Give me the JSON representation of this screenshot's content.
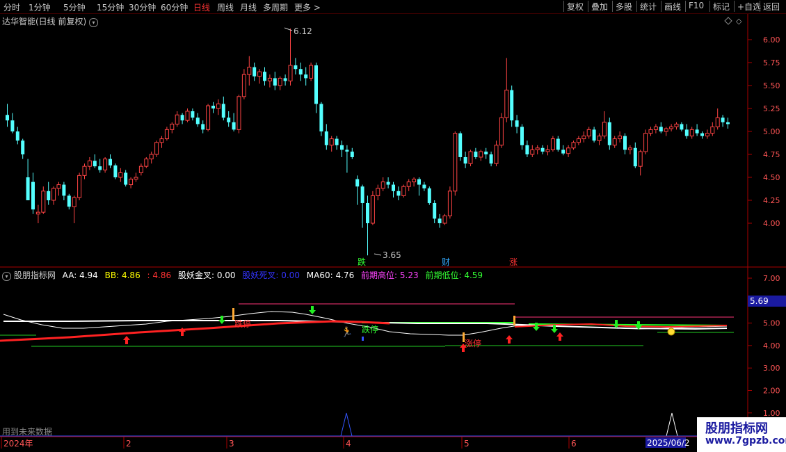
{
  "toolbar": {
    "periods": [
      "分时",
      "1分钟",
      "5分钟",
      "15分钟",
      "30分钟",
      "60分钟",
      "日线",
      "周线",
      "月线",
      "多周期",
      "更多 >"
    ],
    "active_period": "日线",
    "right_buttons": [
      "复权",
      "叠加",
      "多股",
      "统计",
      "画线",
      "F10",
      "标记",
      "+自选",
      "返回"
    ]
  },
  "main_panel": {
    "title": "达华智能(日线 前复权)",
    "high_label": "6.12",
    "low_label": "3.65",
    "y_axis_ticks": [
      "6.00",
      "5.75",
      "5.50",
      "5.25",
      "5.00",
      "4.75",
      "4.50",
      "4.25",
      "4.00"
    ],
    "markers": [
      {
        "text": "跌",
        "color": "#33ff33"
      },
      {
        "text": "财",
        "color": "#33aaff"
      },
      {
        "text": "涨",
        "color": "#ff3333"
      }
    ]
  },
  "indicator_panel": {
    "name": "股朋指标网",
    "values": [
      {
        "label": "AA:",
        "value": "4.94",
        "color": "#ffffff"
      },
      {
        "label": "BB:",
        "value": "4.86",
        "color": "#ffff00"
      },
      {
        "label": "",
        "value": "4.86",
        "color": "#ff3333"
      },
      {
        "label": "股妖金叉:",
        "value": "0.00",
        "color": "#ffffff"
      },
      {
        "label": "股妖死叉:",
        "value": "0.00",
        "color": "#3333ff"
      },
      {
        "label": "MA60:",
        "value": "4.76",
        "color": "#ffffff"
      },
      {
        "label": "前期高位:",
        "value": "5.23",
        "color": "#ff44ff"
      },
      {
        "label": "前期低位:",
        "value": "4.59",
        "color": "#33ff33"
      }
    ],
    "y_axis_ticks": [
      "7.00",
      "6.00",
      "5.00",
      "4.00",
      "3.00",
      "2.00",
      "1.00"
    ],
    "current_value_badge": "5.69",
    "annotations": [
      "跌停",
      "跌停",
      "涨停"
    ],
    "future_data_label": "用到未来数据"
  },
  "date_axis": {
    "labels": [
      "2024年",
      "2",
      "3",
      "4",
      "5",
      "6"
    ],
    "current_date": "2025/06/2"
  },
  "watermark": {
    "line1": "股朋指标网",
    "line2": "www.7gpzb.com"
  },
  "colors": {
    "up": "#ff4444",
    "down": "#54ffff",
    "axis": "#aa0000"
  }
}
